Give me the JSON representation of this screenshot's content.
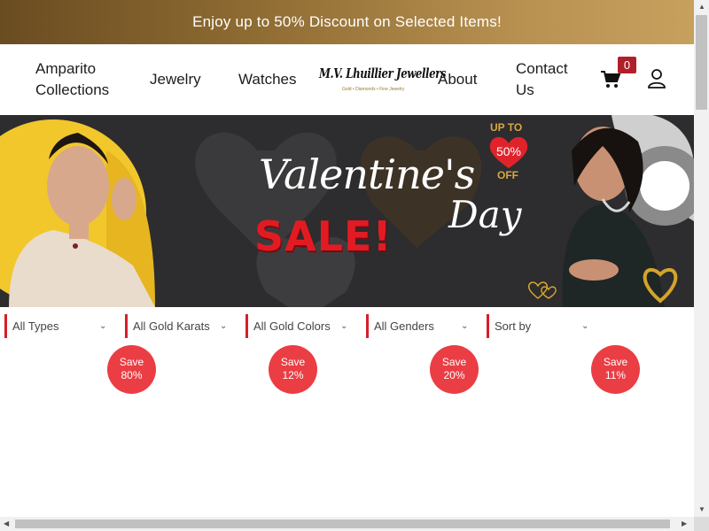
{
  "promo_bar": {
    "text": "Enjoy up to 50% Discount on Selected Items!"
  },
  "nav": {
    "amparito": "Amparito Collections",
    "jewelry": "Jewelry",
    "watches": "Watches",
    "about": "About",
    "contact": "Contact Us"
  },
  "logo": {
    "name": "M.V. Lhuillier Jewellers",
    "tagline": "Gold • Diamonds • Fine Jewelry"
  },
  "cart": {
    "count": "0",
    "icon": "cart-icon"
  },
  "user": {
    "icon": "user-icon"
  },
  "banner": {
    "line1": "Valentine's",
    "line2": "SALE!",
    "line3": "Day",
    "upto": "UP TO",
    "percent": "50%",
    "off": "OFF"
  },
  "filters": [
    {
      "label": "All Types"
    },
    {
      "label": "All Gold Karats"
    },
    {
      "label": "All Gold Colors"
    },
    {
      "label": "All Genders"
    },
    {
      "label": "Sort by"
    }
  ],
  "save_badges": [
    {
      "word": "Save",
      "value": "80%"
    },
    {
      "word": "Save",
      "value": "12%"
    },
    {
      "word": "Save",
      "value": "20%"
    },
    {
      "word": "Save",
      "value": "11%"
    }
  ],
  "colors": {
    "promo_gold": "#b89151",
    "accent_red": "#d51f2a",
    "save_red": "#ea3e44"
  }
}
